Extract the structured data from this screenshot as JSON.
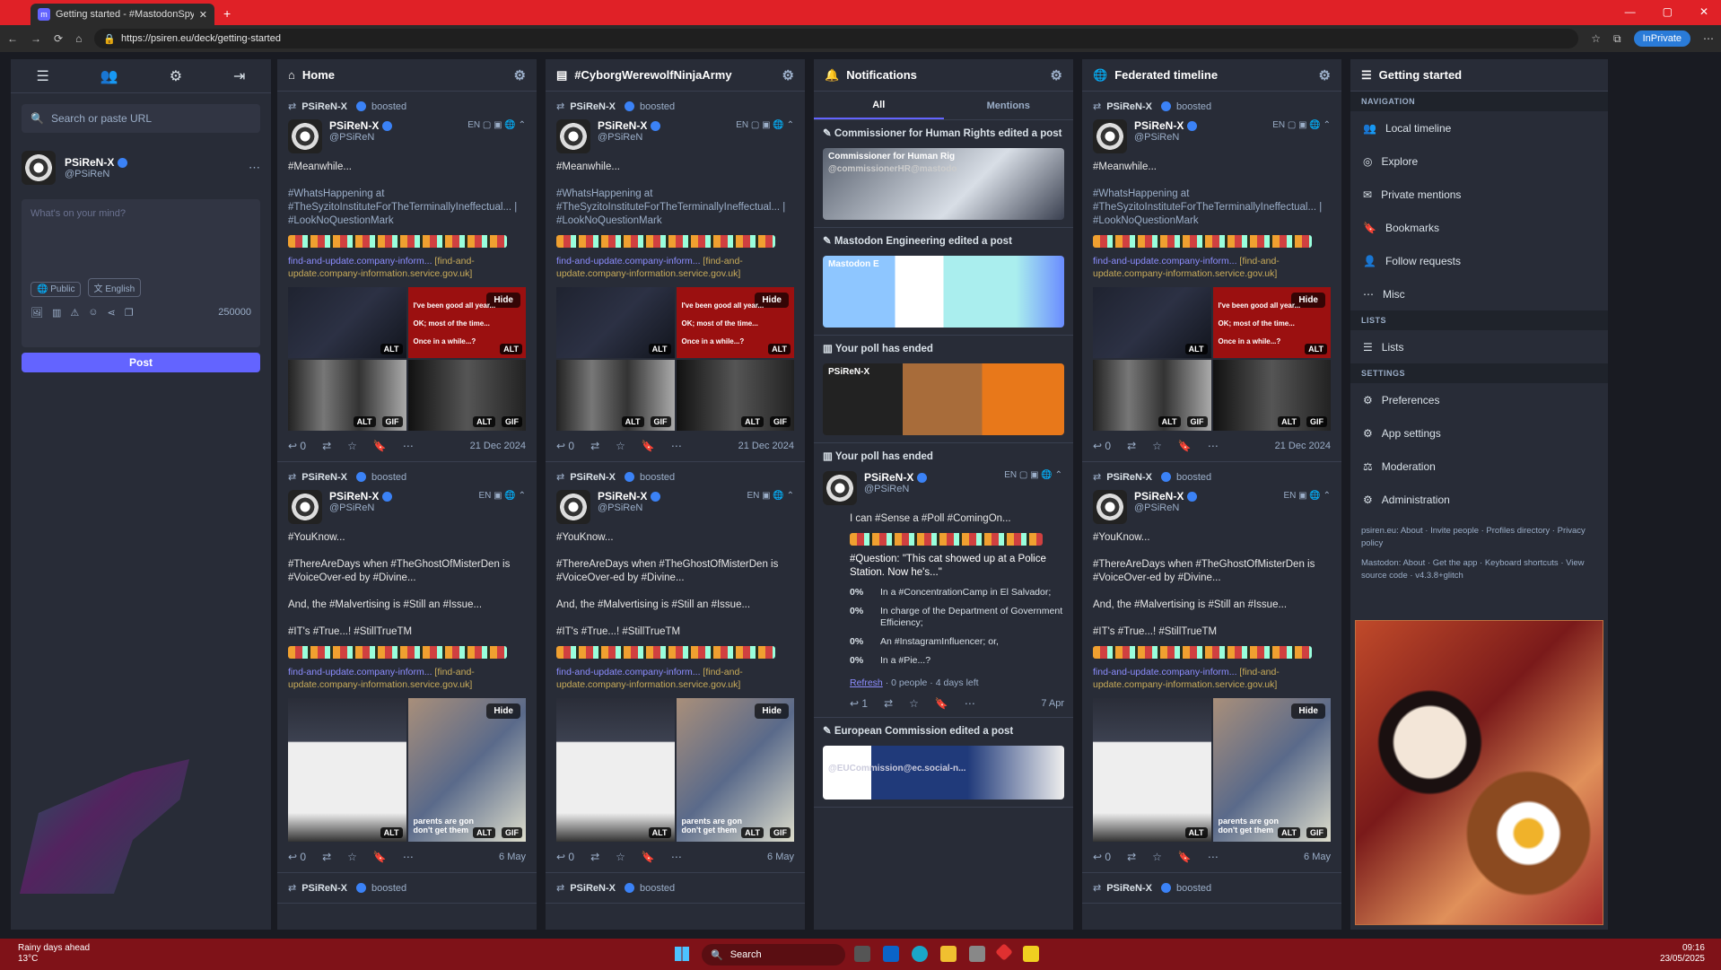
{
  "browser": {
    "tab_title": "Getting started - #MastodonSpyF",
    "url": "https://psiren.eu/deck/getting-started",
    "inprivate": "InPrivate"
  },
  "nav": {
    "search_placeholder": "Search or paste URL",
    "display_name": "PSiReN-X",
    "handle": "@PSiReN",
    "compose_placeholder": "What's on your mind?",
    "visibility": "Public",
    "language": "English",
    "char_count": "250000",
    "post_label": "Post"
  },
  "columns": [
    {
      "title": "Home",
      "icon": "home-icon"
    },
    {
      "title": "#CyborgWerewolfNinjaArmy",
      "icon": "hashtag-icon"
    },
    {
      "title": "Notifications",
      "icon": "bell-icon"
    },
    {
      "title": "Federated timeline",
      "icon": "globe-icon"
    }
  ],
  "status1": {
    "booster": "PSiReN-X",
    "boosted": "boosted",
    "name": "PSiReN-X",
    "handle": "@PSiReN",
    "lang": "EN",
    "l1": "#Meanwhile...",
    "l2": "#WhatsHappening at #TheSyzitoInstituteForTheTerminallyIneffectual... | #LookNoQuestionMark",
    "link": "find-and-update.company-inform...",
    "link_host": "[find-and-update.company-information.service.gov.uk]",
    "red_l1": "I've been good all year...",
    "red_l2": "OK; most of the time...",
    "red_l3": "Once in a while...?",
    "hide": "Hide",
    "alt": "ALT",
    "gif": "GIF",
    "replies": "0",
    "date": "21 Dec 2024"
  },
  "status2": {
    "booster": "PSiReN-X",
    "boosted": "boosted",
    "name": "PSiReN-X",
    "handle": "@PSiReN",
    "lang": "EN",
    "l1": "#YouKnow...",
    "l2": "#ThereAreDays when #TheGhostOfMisterDen is #VoiceOver-ed by #Divine...",
    "l3": "And, the #Malvertising is #Still an #Issue...",
    "l4": "#IT's #True...! #StillTrueTM",
    "link": "find-and-update.company-inform...",
    "link_host": "[find-and-update.company-information.service.gov.uk]",
    "caption": "parents are gon don't get them",
    "hide": "Hide",
    "alt": "ALT",
    "gif": "GIF",
    "replies": "0",
    "date": "6 May"
  },
  "status3": {
    "booster": "PSiReN-X",
    "boosted": "boosted"
  },
  "notifications": {
    "tab_all": "All",
    "tab_mentions": "Mentions",
    "n1": "Commissioner for Human Rights edited a post",
    "n1_name": "Commissioner for Human Rig",
    "n1_handle": "@commissionerHR@mastodo",
    "n2": "Mastodon Engineering edited a post",
    "n2_name": "Mastodon E",
    "n3": "Your poll has ended",
    "n4": "Your poll has ended",
    "poll_name": "PSiReN-X",
    "poll_handle": "@PSiReN",
    "poll_lang": "EN",
    "poll_l1": "I can #Sense a #Poll #ComingOn...",
    "poll_q": "#Question: \"This cat showed up at a Police Station. Now he's...\"",
    "opts": [
      {
        "pct": "0%",
        "text": "In a #ConcentrationCamp in El Salvador;"
      },
      {
        "pct": "0%",
        "text": "In charge of the Department of Government Efficiency;"
      },
      {
        "pct": "0%",
        "text": "An #InstagramInfluencer; or,"
      },
      {
        "pct": "0%",
        "text": "In a #Pie...?"
      }
    ],
    "refresh": "Refresh",
    "poll_meta": "· 0 people · 4 days left",
    "replies": "1",
    "date": "7 Apr",
    "n5": "European Commission edited a post",
    "n5_handle": "@EUCommission@ec.social-n..."
  },
  "getting_started": {
    "title": "Getting started",
    "nav_label": "NAVIGATION",
    "nav_items": [
      "Local timeline",
      "Explore",
      "Private mentions",
      "Bookmarks",
      "Follow requests",
      "Misc"
    ],
    "lists_label": "LISTS",
    "lists_item": "Lists",
    "settings_label": "SETTINGS",
    "settings_items": [
      "Preferences",
      "App settings",
      "Moderation",
      "Administration"
    ],
    "footer1": "psiren.eu: About · Invite people · Profiles directory · Privacy policy",
    "footer2": "Mastodon: About · Get the app · Keyboard shortcuts · View source code · v4.3.8+glitch"
  },
  "taskbar": {
    "weather": "Rainy days ahead",
    "temp": "13°C",
    "search": "Search",
    "time": "09:16",
    "date": "23/05/2025"
  },
  "colors": {
    "accent": "#6364ff",
    "titlebar": "#e02127",
    "taskbar": "#7f1218",
    "column": "#282c37"
  }
}
